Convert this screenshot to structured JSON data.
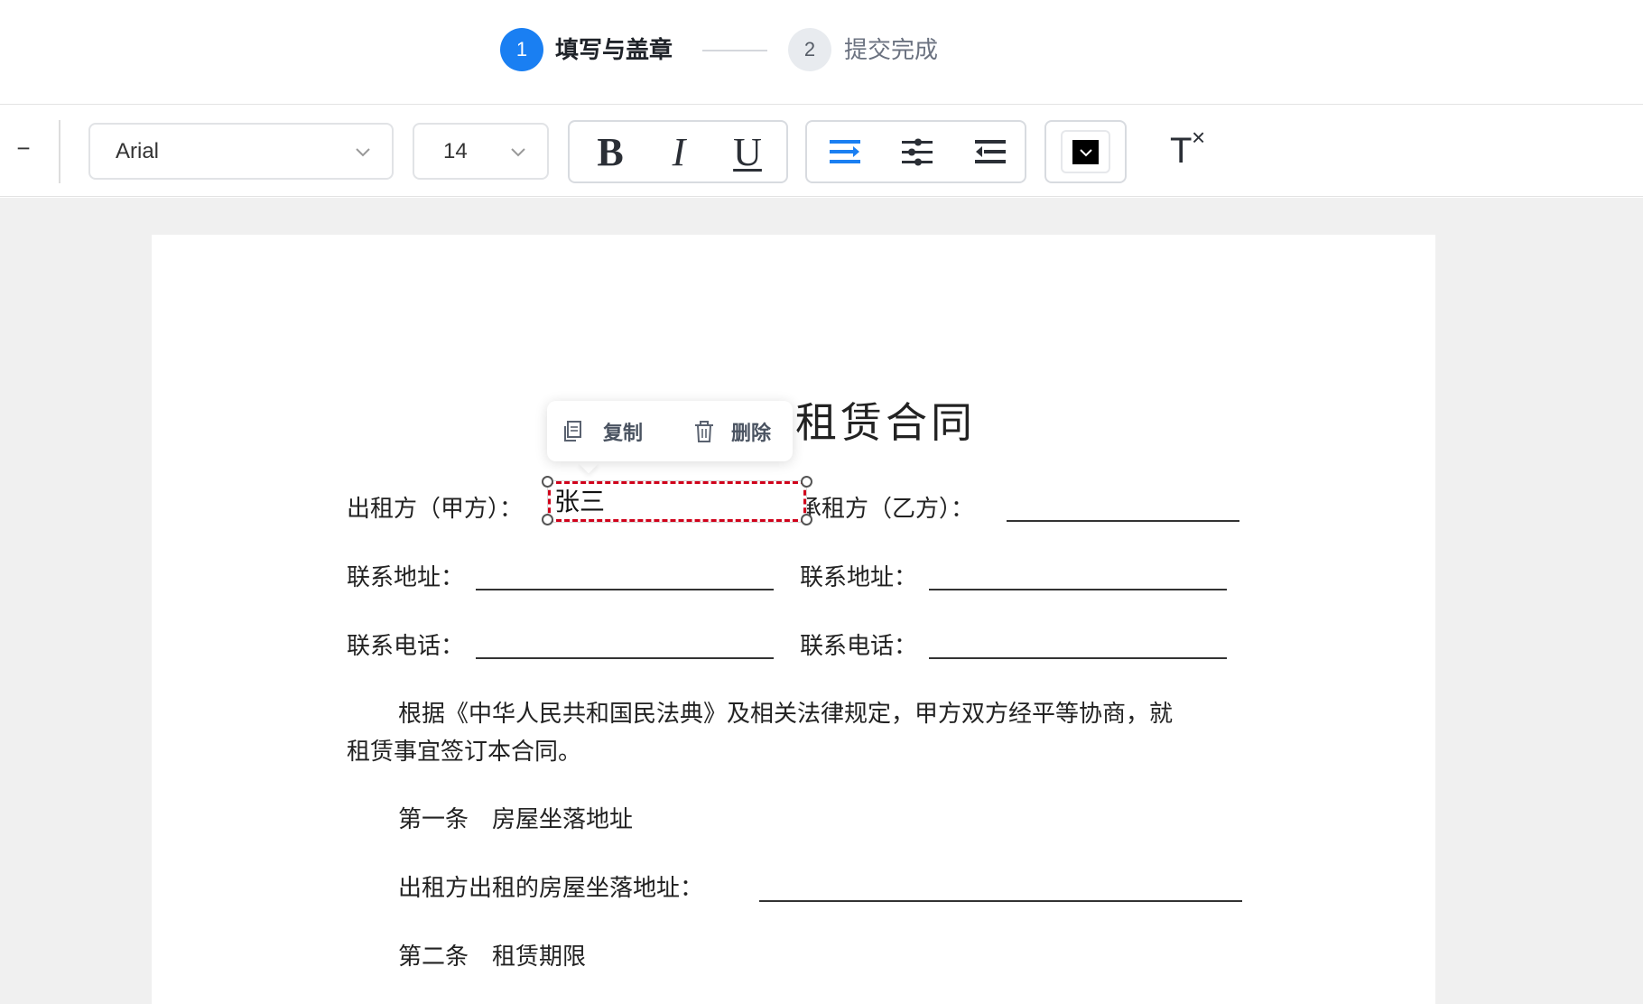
{
  "steps": [
    {
      "number": "1",
      "label": "填写与盖章"
    },
    {
      "number": "2",
      "label": "提交完成"
    }
  ],
  "toolbar": {
    "zoom_out_label": "−",
    "font_family": "Arial",
    "font_size": "14",
    "bold_label": "B",
    "italic_label": "I",
    "underline_label": "U",
    "text_color": "#000000",
    "clear_format_label": "T",
    "clear_format_x": "×"
  },
  "accent_color": "#1a7ff2",
  "popover": {
    "copy_label": "复制",
    "delete_label": "删除"
  },
  "document": {
    "title": "租赁合同",
    "party_a_label": "出租方（甲方）：",
    "party_a_value": "张三",
    "party_b_label": "承租方（乙方）：",
    "address_label_a": "联系地址：",
    "address_label_b": "联系地址：",
    "phone_label_a": "联系电话：",
    "phone_label_b": "联系电话：",
    "intro_line1": "根据《中华人民共和国民法典》及相关法律规定，甲方双方经平等协商，就",
    "intro_line2": "租赁事宜签订本合同。",
    "article1_title": "第一条　房屋坐落地址",
    "article1_field_label": "出租方出租的房屋坐落地址：",
    "article2_title": "第二条　租赁期限"
  }
}
